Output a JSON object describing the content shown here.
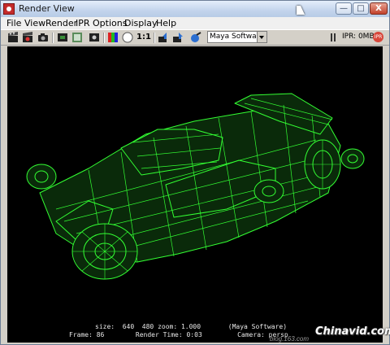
{
  "window": {
    "title": "Render View",
    "minimize_glyph": "—",
    "maximize_glyph": "□",
    "close_glyph": "X"
  },
  "menubar": {
    "items": [
      "File",
      "View",
      "Render",
      "IPR",
      "Options",
      "Display",
      "Help"
    ]
  },
  "toolbar": {
    "icons": [
      "clapper-redo-icon",
      "clapper-render-icon",
      "camera-snapshot-icon",
      "render-region-icon",
      "keep-image-icon",
      "rgb-channel-icon",
      "display-color-icon",
      "alpha-channel-icon",
      "real-size-icon",
      "load-image-icon",
      "save-image-icon",
      "render-globals-icon"
    ],
    "real_size_label": "1:1",
    "renderer": "Maya Software",
    "ipr_status": "IPR: 0MB",
    "ipr_badge": "IPR"
  },
  "render_info": {
    "line1": "size:  640  480 zoom: 1.000       (Maya Software)",
    "line2": "Frame: 86        Render Time: 0:03         Camera: persp"
  },
  "watermark": {
    "url": "blog.163.com",
    "logo": "Chinavid.com"
  },
  "colors": {
    "wireframe": "#33ff33",
    "background": "#000000"
  }
}
